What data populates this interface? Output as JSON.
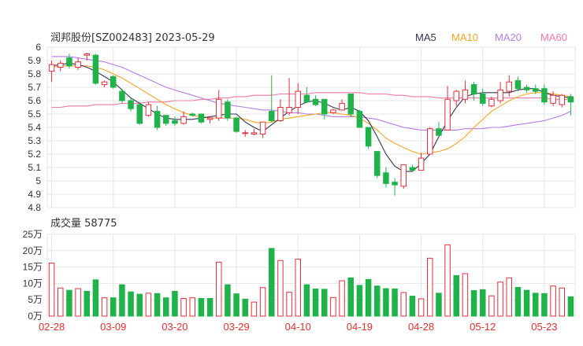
{
  "chart_data": [
    {
      "type": "candlestick",
      "title": "润邦股份[SZ002483] 2023-05-29",
      "ylim": [
        4.8,
        6.0
      ],
      "y_ticks": [
        "6",
        "5.9",
        "5.8",
        "5.7",
        "5.6",
        "5.5",
        "5.4",
        "5.3",
        "5.2",
        "5.1",
        "5",
        "4.9",
        "4.8"
      ],
      "x_tick_labels": [
        "02-28",
        "03-09",
        "03-20",
        "03-29",
        "04-10",
        "04-19",
        "04-28",
        "05-12",
        "05-23"
      ],
      "x_tick_indices": [
        0,
        7,
        14,
        21,
        28,
        35,
        42,
        49,
        56
      ],
      "legend": [
        {
          "name": "MA5",
          "color": "#333355"
        },
        {
          "name": "MA10",
          "color": "#f5a623"
        },
        {
          "name": "MA20",
          "color": "#b57ee0"
        },
        {
          "name": "MA60",
          "color": "#f07aa5"
        }
      ],
      "up_color": "#e0303c",
      "down_color": "#1fb34a",
      "candles": [
        {
          "date": "02-28",
          "o": 5.82,
          "h": 5.9,
          "l": 5.74,
          "c": 5.87
        },
        {
          "o": 5.85,
          "h": 5.9,
          "l": 5.82,
          "c": 5.88
        },
        {
          "o": 5.92,
          "h": 5.95,
          "l": 5.84,
          "c": 5.86
        },
        {
          "o": 5.85,
          "h": 5.92,
          "l": 5.83,
          "c": 5.89
        },
        {
          "o": 5.94,
          "h": 5.96,
          "l": 5.9,
          "c": 5.95
        },
        {
          "o": 5.94,
          "h": 5.95,
          "l": 5.72,
          "c": 5.73
        },
        {
          "o": 5.72,
          "h": 5.75,
          "l": 5.7,
          "c": 5.74
        },
        {
          "date": "03-09",
          "o": 5.78,
          "h": 5.79,
          "l": 5.69,
          "c": 5.7
        },
        {
          "o": 5.67,
          "h": 5.69,
          "l": 5.58,
          "c": 5.6
        },
        {
          "o": 5.6,
          "h": 5.62,
          "l": 5.52,
          "c": 5.54
        },
        {
          "o": 5.57,
          "h": 5.59,
          "l": 5.42,
          "c": 5.43
        },
        {
          "o": 5.49,
          "h": 5.59,
          "l": 5.48,
          "c": 5.57
        },
        {
          "o": 5.52,
          "h": 5.56,
          "l": 5.38,
          "c": 5.4
        },
        {
          "o": 5.49,
          "h": 5.49,
          "l": 5.41,
          "c": 5.43
        },
        {
          "date": "03-20",
          "o": 5.45,
          "h": 5.48,
          "l": 5.41,
          "c": 5.43
        },
        {
          "o": 5.43,
          "h": 5.52,
          "l": 5.42,
          "c": 5.48
        },
        {
          "o": 5.5,
          "h": 5.51,
          "l": 5.48,
          "c": 5.49
        },
        {
          "o": 5.5,
          "h": 5.5,
          "l": 5.43,
          "c": 5.44
        },
        {
          "o": 5.46,
          "h": 5.48,
          "l": 5.43,
          "c": 5.47
        },
        {
          "o": 5.47,
          "h": 5.68,
          "l": 5.45,
          "c": 5.61
        },
        {
          "o": 5.59,
          "h": 5.61,
          "l": 5.45,
          "c": 5.47
        },
        {
          "date": "03-29",
          "o": 5.47,
          "h": 5.48,
          "l": 5.36,
          "c": 5.37
        },
        {
          "o": 5.36,
          "h": 5.38,
          "l": 5.33,
          "c": 5.36
        },
        {
          "o": 5.35,
          "h": 5.39,
          "l": 5.34,
          "c": 5.36
        },
        {
          "o": 5.35,
          "h": 5.44,
          "l": 5.32,
          "c": 5.44
        },
        {
          "o": 5.52,
          "h": 5.79,
          "l": 5.44,
          "c": 5.45
        },
        {
          "o": 5.45,
          "h": 5.61,
          "l": 5.44,
          "c": 5.55
        },
        {
          "o": 5.51,
          "h": 5.77,
          "l": 5.49,
          "c": 5.55
        },
        {
          "date": "04-10",
          "o": 5.55,
          "h": 5.73,
          "l": 5.5,
          "c": 5.67
        },
        {
          "o": 5.64,
          "h": 5.7,
          "l": 5.58,
          "c": 5.59
        },
        {
          "o": 5.61,
          "h": 5.64,
          "l": 5.56,
          "c": 5.57
        },
        {
          "o": 5.61,
          "h": 5.61,
          "l": 5.46,
          "c": 5.5
        },
        {
          "o": 5.51,
          "h": 5.54,
          "l": 5.5,
          "c": 5.53
        },
        {
          "o": 5.53,
          "h": 5.61,
          "l": 5.53,
          "c": 5.58
        },
        {
          "o": 5.65,
          "h": 5.65,
          "l": 5.48,
          "c": 5.5
        },
        {
          "date": "04-19",
          "o": 5.52,
          "h": 5.53,
          "l": 5.4,
          "c": 5.4
        },
        {
          "o": 5.4,
          "h": 5.4,
          "l": 5.24,
          "c": 5.26
        },
        {
          "o": 5.22,
          "h": 5.22,
          "l": 5.02,
          "c": 5.04
        },
        {
          "o": 5.06,
          "h": 5.1,
          "l": 4.95,
          "c": 4.98
        },
        {
          "o": 4.99,
          "h": 5.02,
          "l": 4.89,
          "c": 4.97
        },
        {
          "o": 4.96,
          "h": 5.12,
          "l": 4.94,
          "c": 5.12
        },
        {
          "o": 5.1,
          "h": 5.12,
          "l": 5.07,
          "c": 5.08
        },
        {
          "date": "04-28",
          "o": 5.08,
          "h": 5.21,
          "l": 5.08,
          "c": 5.17
        },
        {
          "o": 5.2,
          "h": 5.4,
          "l": 5.2,
          "c": 5.39
        },
        {
          "o": 5.39,
          "h": 5.44,
          "l": 5.34,
          "c": 5.34
        },
        {
          "o": 5.38,
          "h": 5.71,
          "l": 5.38,
          "c": 5.61
        },
        {
          "o": 5.6,
          "h": 5.68,
          "l": 5.56,
          "c": 5.67
        },
        {
          "o": 5.61,
          "h": 5.75,
          "l": 5.58,
          "c": 5.68
        },
        {
          "o": 5.72,
          "h": 5.74,
          "l": 5.6,
          "c": 5.65
        },
        {
          "date": "05-12",
          "o": 5.65,
          "h": 5.69,
          "l": 5.56,
          "c": 5.58
        },
        {
          "o": 5.56,
          "h": 5.63,
          "l": 5.55,
          "c": 5.61
        },
        {
          "o": 5.6,
          "h": 5.74,
          "l": 5.58,
          "c": 5.68
        },
        {
          "o": 5.67,
          "h": 5.79,
          "l": 5.63,
          "c": 5.74
        },
        {
          "o": 5.75,
          "h": 5.78,
          "l": 5.67,
          "c": 5.69
        },
        {
          "o": 5.7,
          "h": 5.72,
          "l": 5.66,
          "c": 5.68
        },
        {
          "o": 5.69,
          "h": 5.72,
          "l": 5.65,
          "c": 5.67
        },
        {
          "date": "05-23",
          "o": 5.69,
          "h": 5.72,
          "l": 5.57,
          "c": 5.59
        },
        {
          "o": 5.58,
          "h": 5.67,
          "l": 5.56,
          "c": 5.64
        },
        {
          "o": 5.57,
          "h": 5.65,
          "l": 5.55,
          "c": 5.64
        },
        {
          "o": 5.63,
          "h": 5.65,
          "l": 5.49,
          "c": 5.59
        }
      ],
      "ma5": [
        5.86,
        5.87,
        5.88,
        5.87,
        5.85,
        5.82,
        5.78,
        5.74,
        5.68,
        5.62,
        5.58,
        5.54,
        5.5,
        5.47,
        5.46,
        5.46,
        5.46,
        5.47,
        5.48,
        5.49,
        5.5,
        5.5,
        5.44,
        5.4,
        5.37,
        5.42,
        5.47,
        5.52,
        5.56,
        5.59,
        5.6,
        5.58,
        5.55,
        5.53,
        5.55,
        5.52,
        5.45,
        5.33,
        5.2,
        5.11,
        5.07,
        5.07,
        5.13,
        5.2,
        5.33,
        5.45,
        5.55,
        5.63,
        5.65,
        5.66,
        5.66,
        5.66,
        5.66,
        5.68,
        5.69,
        5.69,
        5.66,
        5.64,
        5.63,
        5.62
      ],
      "ma10": [
        5.85,
        5.86,
        5.86,
        5.86,
        5.86,
        5.85,
        5.83,
        5.8,
        5.77,
        5.73,
        5.69,
        5.65,
        5.61,
        5.57,
        5.54,
        5.51,
        5.49,
        5.48,
        5.47,
        5.47,
        5.47,
        5.47,
        5.46,
        5.44,
        5.43,
        5.44,
        5.46,
        5.47,
        5.48,
        5.49,
        5.5,
        5.51,
        5.51,
        5.5,
        5.49,
        5.47,
        5.43,
        5.38,
        5.32,
        5.28,
        5.25,
        5.22,
        5.2,
        5.21,
        5.22,
        5.24,
        5.28,
        5.33,
        5.4,
        5.46,
        5.52,
        5.56,
        5.6,
        5.63,
        5.65,
        5.66,
        5.66,
        5.65,
        5.64,
        5.63
      ],
      "ma20": [
        5.93,
        5.93,
        5.93,
        5.92,
        5.91,
        5.9,
        5.89,
        5.87,
        5.85,
        5.82,
        5.79,
        5.76,
        5.73,
        5.7,
        5.68,
        5.66,
        5.64,
        5.62,
        5.6,
        5.58,
        5.57,
        5.56,
        5.55,
        5.54,
        5.53,
        5.53,
        5.52,
        5.51,
        5.51,
        5.5,
        5.5,
        5.49,
        5.48,
        5.48,
        5.48,
        5.48,
        5.47,
        5.46,
        5.44,
        5.42,
        5.4,
        5.39,
        5.38,
        5.38,
        5.38,
        5.38,
        5.38,
        5.39,
        5.39,
        5.39,
        5.4,
        5.4,
        5.41,
        5.42,
        5.43,
        5.44,
        5.45,
        5.47,
        5.49,
        5.52
      ],
      "ma60": [
        5.55,
        5.55,
        5.56,
        5.56,
        5.56,
        5.57,
        5.57,
        5.57,
        5.58,
        5.58,
        5.58,
        5.59,
        5.59,
        5.59,
        5.6,
        5.6,
        5.6,
        5.61,
        5.61,
        5.62,
        5.62,
        5.63,
        5.63,
        5.64,
        5.64,
        5.64,
        5.65,
        5.65,
        5.65,
        5.65,
        5.66,
        5.66,
        5.66,
        5.66,
        5.66,
        5.66,
        5.65,
        5.65,
        5.65,
        5.64,
        5.64,
        5.63,
        5.63,
        5.63,
        5.62,
        5.62,
        5.62,
        5.62,
        5.62,
        5.62,
        5.62,
        5.62,
        5.62,
        5.62,
        5.62,
        5.62,
        5.62,
        5.61,
        5.61,
        5.61
      ]
    },
    {
      "type": "bar",
      "title": "成交量 58775",
      "ylim": [
        0,
        25
      ],
      "y_ticks": [
        "25万",
        "20万",
        "15万",
        "10万",
        "5万",
        "0万"
      ],
      "x_tick_labels": [
        "02-28",
        "03-09",
        "03-20",
        "03-29",
        "04-10",
        "04-19",
        "04-28",
        "05-12",
        "05-23"
      ],
      "volumes": [
        16.2,
        8.6,
        7.9,
        8.4,
        7.6,
        11.1,
        5.6,
        5.6,
        9.6,
        7.4,
        6.7,
        7.0,
        6.9,
        5.6,
        7.6,
        5.4,
        5.6,
        5.4,
        5.4,
        16.5,
        9.6,
        6.8,
        5.2,
        4.3,
        8.7,
        20.7,
        17.0,
        7.3,
        17.4,
        9.6,
        8.3,
        8.2,
        5.7,
        10.8,
        11.7,
        9.4,
        11.2,
        9.2,
        8.4,
        8.3,
        7.2,
        6.1,
        5.3,
        17.7,
        7.0,
        21.8,
        12.4,
        13.0,
        7.8,
        8.1,
        6.2,
        10.4,
        11.7,
        8.8,
        7.9,
        7.0,
        6.9,
        9.2,
        8.6,
        5.9
      ],
      "up": [
        true,
        true,
        false,
        true,
        false,
        false,
        true,
        false,
        false,
        false,
        false,
        true,
        false,
        false,
        false,
        true,
        true,
        false,
        false,
        true,
        false,
        false,
        false,
        true,
        true,
        false,
        true,
        true,
        true,
        false,
        false,
        false,
        true,
        true,
        false,
        false,
        false,
        false,
        false,
        false,
        true,
        false,
        true,
        true,
        false,
        true,
        false,
        true,
        false,
        false,
        true,
        true,
        true,
        false,
        false,
        false,
        false,
        true,
        true,
        false
      ]
    }
  ]
}
